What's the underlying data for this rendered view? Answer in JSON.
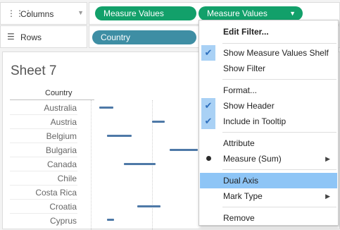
{
  "shelves": {
    "columns": {
      "label": "Columns",
      "icon": "columns-icon",
      "pills": [
        "Measure Values",
        "Measure Values"
      ]
    },
    "rows": {
      "label": "Rows",
      "icon": "rows-icon",
      "pills": [
        "Country"
      ]
    }
  },
  "sheet": {
    "title": "Sheet 7",
    "row_header": "Country",
    "countries": [
      "Australia",
      "Austria",
      "Belgium",
      "Bulgaria",
      "Canada",
      "Chile",
      "Costa Rica",
      "Croatia",
      "Cyprus"
    ]
  },
  "context_menu": {
    "items": [
      {
        "label": "Edit Filter...",
        "bold": true
      },
      {
        "label": "Show Measure Values Shelf",
        "checked": true
      },
      {
        "label": "Show Filter"
      },
      {
        "label": "Format..."
      },
      {
        "label": "Show Header",
        "checked": true
      },
      {
        "label": "Include in Tooltip",
        "checked": true
      },
      {
        "label": "Attribute"
      },
      {
        "label": "Measure (Sum)",
        "selected": true,
        "submenu": true
      },
      {
        "label": "Dual Axis",
        "highlighted": true
      },
      {
        "label": "Mark Type",
        "submenu": true
      },
      {
        "label": "Remove"
      }
    ]
  },
  "colors": {
    "pill_measure": "#12a06a",
    "pill_dimension": "#3e8ea4",
    "bar": "#4e79a7",
    "menu_highlight": "#8ec5f6",
    "check_bg": "#a9d1f5"
  }
}
